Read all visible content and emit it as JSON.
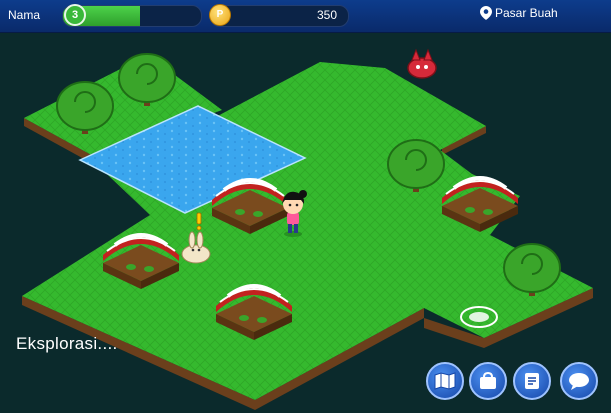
{
  "hud": {
    "player_label": "Nama",
    "level": "3",
    "level_progress": 0.56,
    "coin_symbol": "P",
    "coins": "350",
    "location": "Pasar Buah"
  },
  "status_text": "Eksplorasi....",
  "colors": {
    "hud_bar": "#0d3c8c",
    "grass": "#33b52c",
    "water": "#3aa6ee",
    "stall_red": "#c2221f",
    "background": "#0b2a2c"
  },
  "bottom_buttons": [
    "map-icon",
    "bag-icon",
    "quest-scroll-icon",
    "chat-icon"
  ]
}
